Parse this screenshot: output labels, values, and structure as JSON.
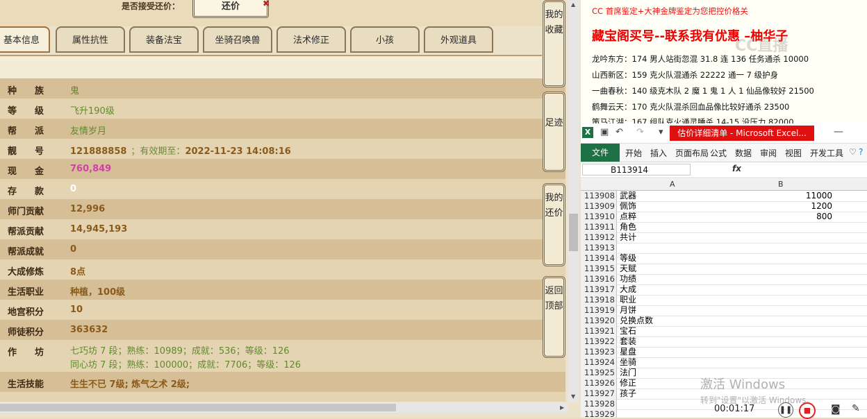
{
  "left_panel": {
    "accept_offer_label": "是否接受还价：",
    "offer_button": "还价",
    "tabs": [
      "基本信息",
      "属性抗性",
      "装备法宝",
      "坐骑召唤兽",
      "法术修正",
      "小孩",
      "外观道具"
    ],
    "rows": [
      {
        "label": "种　　族",
        "value": "鬼"
      },
      {
        "label": "等　　级",
        "value": "飞升190级"
      },
      {
        "label": "帮　　派",
        "value": "友情岁月"
      },
      {
        "label": "靓　　号",
        "value": "121888858",
        "validity_label": "；有效期至：",
        "validity_date": "2022-11-23 14:08:16"
      },
      {
        "label": "现　　金",
        "value": "760,849"
      },
      {
        "label": "存　　款",
        "value": "0"
      },
      {
        "label": "师门贡献",
        "value": "12,996"
      },
      {
        "label": "帮派贡献",
        "value": "14,945,193"
      },
      {
        "label": "帮派成就",
        "value": "0"
      },
      {
        "label": "大成修炼",
        "value": "8点"
      },
      {
        "label": "生活职业",
        "value": "种植，100级"
      },
      {
        "label": "地宫积分",
        "value": "10"
      },
      {
        "label": "师徒积分",
        "value": "363632"
      },
      {
        "label": "作　　坊",
        "value_line1": "七巧坊 7 段；熟练：10989；成就：536；等级：126",
        "value_line2": "同心坊 7 段；熟练：100000；成就：7706；等级：126"
      },
      {
        "label": "生活技能",
        "value": "生生不已 7级; 炼气之术 2级;"
      }
    ],
    "side_buttons": [
      "我的收藏",
      "足迹",
      "我的还价",
      "返回顶部"
    ]
  },
  "document": {
    "line1": "CC 首席鉴定+大神金牌鉴定为您把控价格关",
    "line2": "藏宝阁买号--联系我有优惠 –柚华子",
    "watermark": "CC直播",
    "lines": [
      "龙吟东方：174 男人站街忽混 31.8 连 136 任务通杀 10000",
      "山西新区：159 克火队混通杀 22222 通一 7 级护身",
      "一曲春秋：140 级克木队 2 魔 1 鬼 1 人 1 仙品像较好 21500",
      "鹤舞云天：170 克火队混杀回血品像比较好通杀 23500",
      "策马江湖：167 组队克火通灵睡杀 14-15 没压力 82000"
    ]
  },
  "excel": {
    "window_title": "估价详细清单 - Microsoft Excel...",
    "ribbon_tabs": [
      "文件",
      "开始",
      "插入",
      "页面布局",
      "公式",
      "数据",
      "审阅",
      "视图",
      "开发工具"
    ],
    "name_box": "B113914",
    "fx_label": "fx",
    "columns": [
      "A",
      "B"
    ],
    "rows": [
      {
        "n": "113908",
        "a": "武器",
        "b": "11000"
      },
      {
        "n": "113909",
        "a": "佩饰",
        "b": "1200"
      },
      {
        "n": "113910",
        "a": "点粹",
        "b": "800"
      },
      {
        "n": "113911",
        "a": "角色",
        "b": ""
      },
      {
        "n": "113912",
        "a": "共计",
        "b": ""
      },
      {
        "n": "113913",
        "a": "",
        "b": ""
      },
      {
        "n": "113914",
        "a": "等级",
        "b": ""
      },
      {
        "n": "113915",
        "a": "天赋",
        "b": ""
      },
      {
        "n": "113916",
        "a": "功绩",
        "b": ""
      },
      {
        "n": "113917",
        "a": "大成",
        "b": ""
      },
      {
        "n": "113918",
        "a": "职业",
        "b": ""
      },
      {
        "n": "113919",
        "a": "月饼",
        "b": ""
      },
      {
        "n": "113920",
        "a": "兑换点数",
        "b": ""
      },
      {
        "n": "113921",
        "a": "宝石",
        "b": ""
      },
      {
        "n": "113922",
        "a": "套装",
        "b": ""
      },
      {
        "n": "113923",
        "a": "星盘",
        "b": ""
      },
      {
        "n": "113924",
        "a": "坐骑",
        "b": ""
      },
      {
        "n": "113925",
        "a": "法门",
        "b": ""
      },
      {
        "n": "113926",
        "a": "修正",
        "b": ""
      },
      {
        "n": "113927",
        "a": "孩子",
        "b": ""
      },
      {
        "n": "113928",
        "a": "",
        "b": ""
      },
      {
        "n": "113929",
        "a": "",
        "b": ""
      }
    ],
    "activate_line1": "激活 Windows",
    "activate_line2": "转到\"设置\"以激活 Windows。",
    "timer": "00:01:17"
  },
  "colors": {
    "accent_pink": "#d13fa8",
    "excel_green": "#1e7145",
    "title_red": "#e01010"
  }
}
